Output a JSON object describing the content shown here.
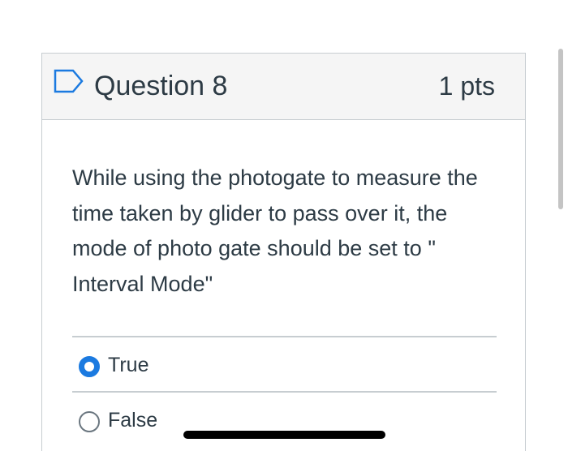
{
  "question": {
    "title": "Question 8",
    "points": "1 pts",
    "text": "While using the photogate to measure the time taken by glider to pass over it, the mode of photo gate should be set to \" Interval Mode\"",
    "flag_icon": "flag-outline-icon"
  },
  "answers": [
    {
      "label": "True",
      "selected": true
    },
    {
      "label": "False",
      "selected": false
    }
  ],
  "colors": {
    "accent": "#1b7ae0",
    "text": "#2d3b45",
    "border": "#c7cdd1",
    "header_bg": "#f5f5f5"
  }
}
